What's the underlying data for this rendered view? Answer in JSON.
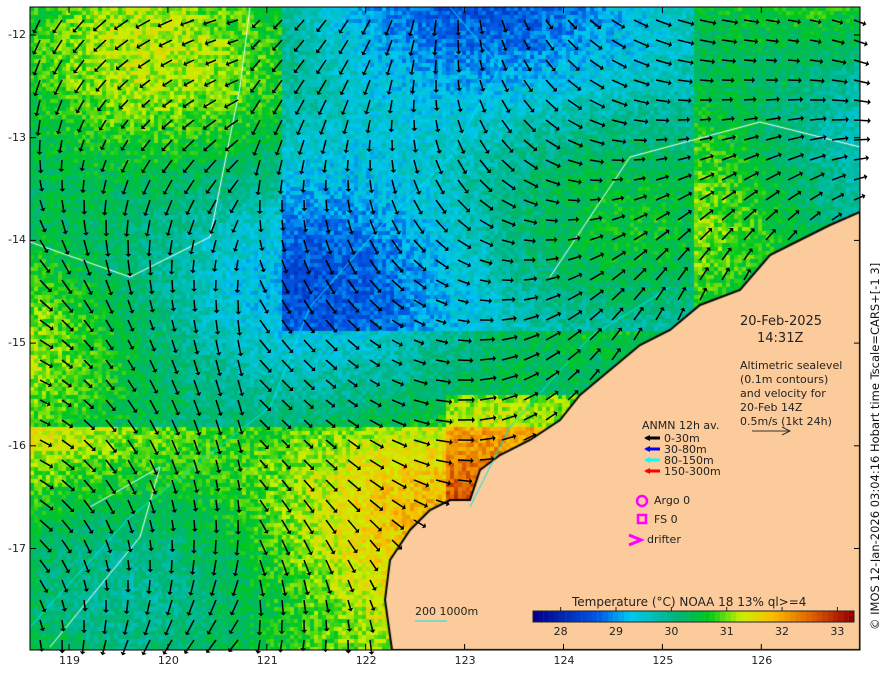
{
  "map": {
    "lon_ticks": [
      "119",
      "120",
      "121",
      "122",
      "123",
      "124",
      "125",
      "126"
    ],
    "lat_ticks": [
      "-12",
      "-13",
      "-14",
      "-15",
      "-16",
      "-17"
    ],
    "colors": {
      "land": "#fbcb9b",
      "coastline": "#000000",
      "contours_deep": "#ffffff",
      "contours_shallow": "#00e5ee"
    }
  },
  "timestamp": {
    "date": "20-Feb-2025",
    "time": "14:31Z"
  },
  "description": [
    "Altimetric sealevel",
    "(0.1m contours)",
    "and velocity for",
    "20-Feb 14Z",
    "0.5m/s (1kt 24h)"
  ],
  "anmn_legend": {
    "title": "ANMN 12h av.",
    "items": [
      {
        "label": "0-30m",
        "color": "#000000"
      },
      {
        "label": "30-80m",
        "color": "#0000ff"
      },
      {
        "label": "80-150m",
        "color": "#00ffff"
      },
      {
        "label": "150-300m",
        "color": "#ff0000"
      }
    ]
  },
  "markers": [
    {
      "label": "Argo 0",
      "icon": "circle-icon",
      "color": "#ff00ff"
    },
    {
      "label": "FS 0",
      "icon": "square-icon",
      "color": "#ff00ff"
    },
    {
      "label": "drifter",
      "icon": "chevron-icon",
      "color": "#ff00ff"
    }
  ],
  "bathy_legend": {
    "label": "200  1000m"
  },
  "colorbar": {
    "title": "Temperature (°C) NOAA 18 13% ql>=4",
    "ticks": [
      "28",
      "29",
      "30",
      "31",
      "32",
      "33"
    ],
    "range": [
      27.5,
      33.3
    ]
  },
  "side_label": "© IMOS 12-Jan-2026 03:04:16 Hobart time Tscale=CARS+[-1 3]"
}
